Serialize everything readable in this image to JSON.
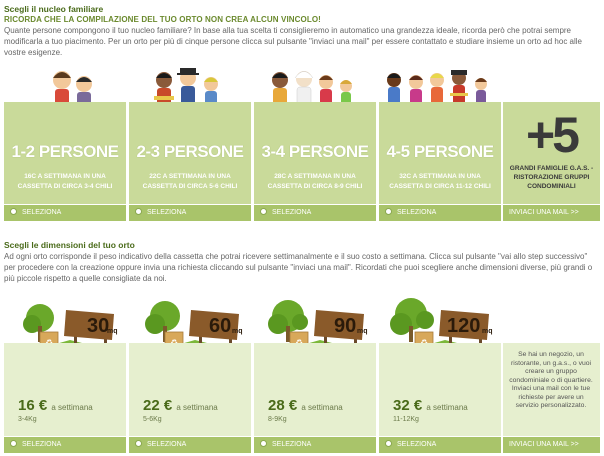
{
  "family": {
    "title": "Scegli il nucleo familiare",
    "intro_caps": "RICORDA CHE LA COMPILAZIONE DEL TUO ORTO NON CREA ALCUN VINCOLO!",
    "intro_body": "Quante persone compongono il tuo nucleo familiare? In base alla tua scelta ti consiglieremo in automatico una grandezza ideale, ricorda però che potrai sempre modificarla a tuo piacimento. Per un orto per più di cinque persone clicca sul pulsante \"inviaci una mail\" per essere contattato e studiare insieme un orto ad hoc alle vostre esigenze.",
    "options": [
      {
        "big": "1-2 PERSONE",
        "sub": "16C A SETTIMANA IN UNA CASSETTA DI CIRCA 3-4 CHILI",
        "select": "SELEZIONA"
      },
      {
        "big": "2-3 PERSONE",
        "sub": "22C A SETTIMANA IN UNA CASSETTA DI CIRCA 5-6 CHILI",
        "select": "SELEZIONA"
      },
      {
        "big": "3-4 PERSONE",
        "sub": "28C A SETTIMANA IN UNA CASSETTA DI CIRCA 8-9 CHILI",
        "select": "SELEZIONA"
      },
      {
        "big": "4-5 PERSONE",
        "sub": "32C A SETTIMANA IN UNA CASSETTA DI CIRCA 11-12 CHILI",
        "select": "SELEZIONA"
      }
    ],
    "more": {
      "big": "+5",
      "text": "GRANDI FAMIGLIE G.A.S. - RISTORAZIONE GRUPPI CONDOMINIALI",
      "mail": "INVIACI UNA MAIL >>"
    }
  },
  "sizes": {
    "title": "Scegli le dimensioni del tuo orto",
    "intro": "Ad ogni orto corrisponde il peso indicativo della cassetta che potrai ricevere settimanalmente e il suo costo a settimana. Clicca sul pulsante \"vai allo step successivo\" per procedere con la creazione oppure invia una richiesta cliccando sul pulsante \"inviaci una mail\". Ricordati che puoi scegliere anche dimensioni diverse, più grandi o più piccole rispetto a quelle consigliate da noi.",
    "options": [
      {
        "sign": "30",
        "unit": "mq",
        "price": "16 €",
        "per": "a settimana",
        "kg": "3-4Kg",
        "select": "SELEZIONA"
      },
      {
        "sign": "60",
        "unit": "mq",
        "price": "22 €",
        "per": "a settimana",
        "kg": "5-6Kg",
        "select": "SELEZIONA"
      },
      {
        "sign": "90",
        "unit": "mq",
        "price": "28 €",
        "per": "a settimana",
        "kg": "8-9Kg",
        "select": "SELEZIONA"
      },
      {
        "sign": "120",
        "unit": "mq",
        "price": "32 €",
        "per": "a settimana",
        "kg": "11-12Kg",
        "select": "SELEZIONA"
      }
    ],
    "info": "Se hai un negozio, un ristorante, un g.a.s., o vuoi creare un gruppo condominiale o di quartiere. Inviaci una mail con le tue richieste per avere un servizio personalizzato.",
    "mail": "INVIACI UNA MAIL >>"
  },
  "colors": {
    "card": "#c9da9a",
    "bar": "#a9c46a",
    "title": "#4a6b1a"
  }
}
